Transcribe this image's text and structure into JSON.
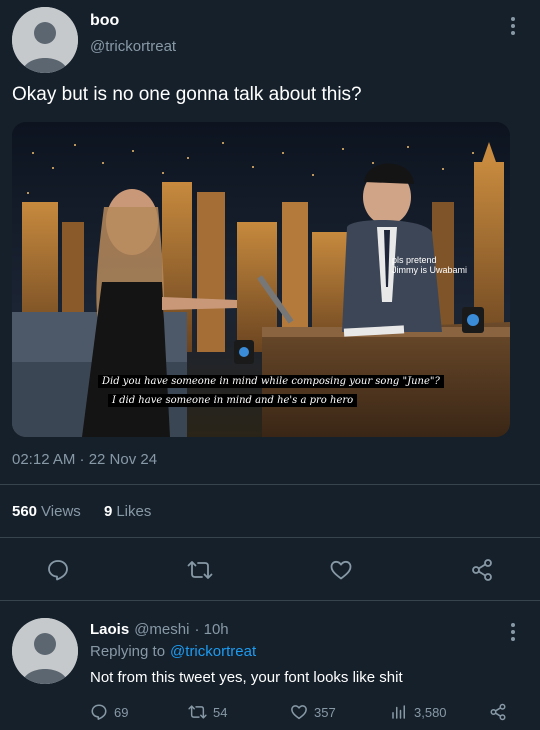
{
  "tweet": {
    "display_name": "boo",
    "handle": "@trickortreat",
    "text": "Okay but is no one gonna talk about this?",
    "timestamp": "02:12 AM · 22 Nov 24",
    "views_count": "560",
    "views_label": "Views",
    "likes_count": "9",
    "likes_label": "Likes",
    "image": {
      "watermark": "pls pretend\nJimmy is Uwabami",
      "caption_line1": "Did you have someone in mind while composing your song \"June\"?",
      "caption_line2": "I did have someone in mind and he's a pro hero"
    }
  },
  "reply": {
    "display_name": "Laois",
    "handle": "@meshi",
    "time": "· 10h",
    "replying_prefix": "Replying to",
    "replying_to": "@trickortreat",
    "text": "Not from this tweet yes, your font looks like shit",
    "stats": {
      "replies": "69",
      "retweets": "54",
      "likes": "357",
      "views": "3,580"
    }
  },
  "colors": {
    "background": "#15202b",
    "muted": "#8899a6",
    "link": "#1d9bf0",
    "divider": "#38444d"
  },
  "icons": [
    "reply-icon",
    "retweet-icon",
    "like-icon",
    "share-icon",
    "views-icon",
    "more-icon"
  ]
}
